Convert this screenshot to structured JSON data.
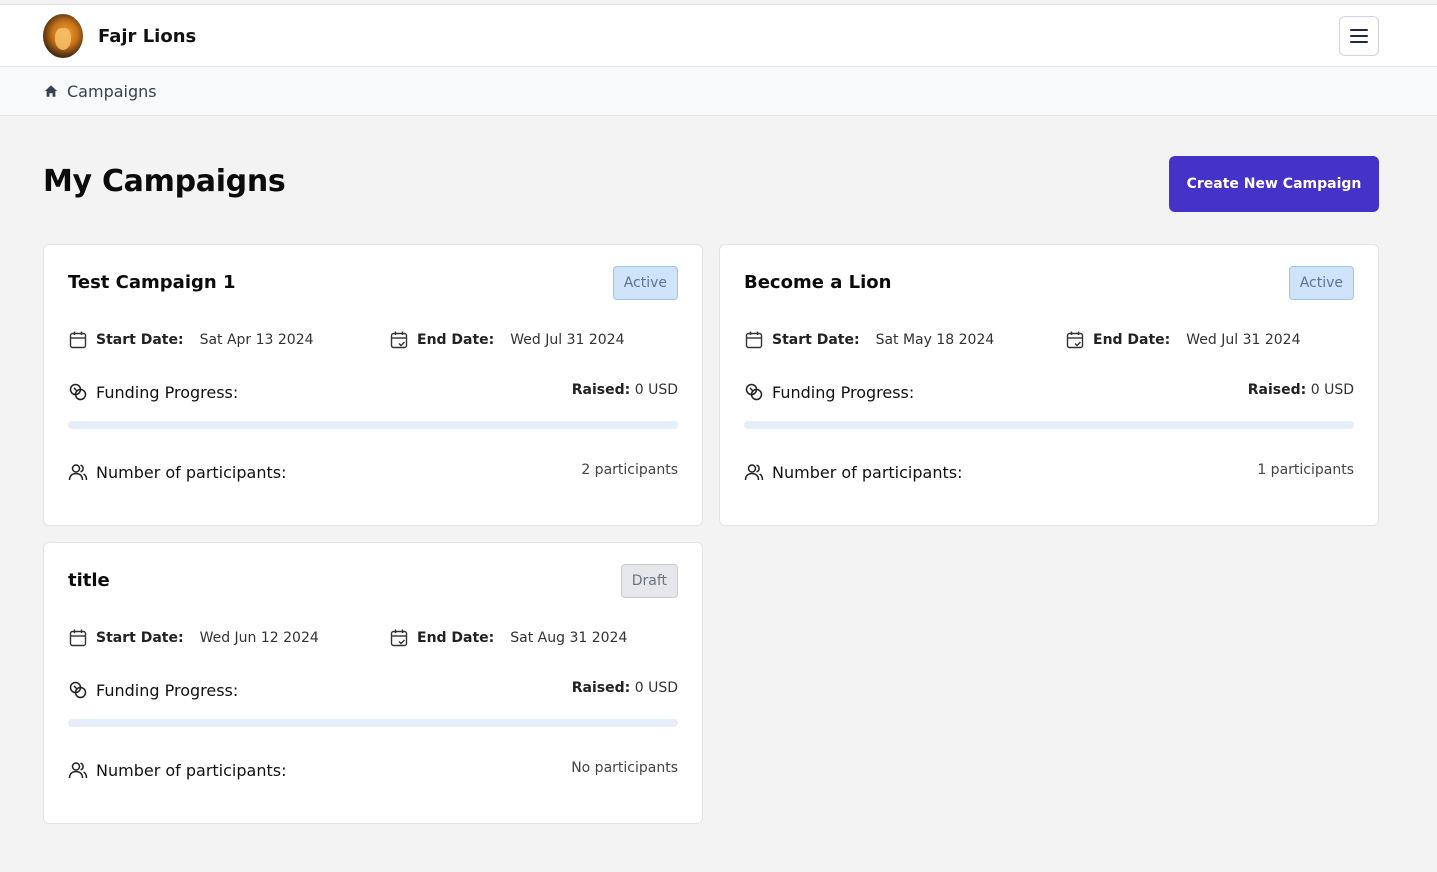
{
  "header": {
    "brand": "Fajr Lions",
    "logo_icon": "lion-logo-icon",
    "menu_icon": "hamburger-menu-icon"
  },
  "breadcrumb": {
    "home_icon": "home-icon",
    "current": "Campaigns"
  },
  "main": {
    "title": "My Campaigns",
    "create_button": "Create New Campaign",
    "accent_color": "#4533c9"
  },
  "labels": {
    "start_date": "Start Date:",
    "end_date": "End Date:",
    "funding_progress": "Funding Progress:",
    "raised": "Raised:",
    "participants": "Number of participants:"
  },
  "campaigns": [
    {
      "title": "Test Campaign 1",
      "status": "Active",
      "start_date": "Sat Apr 13 2024",
      "end_date": "Wed Jul 31 2024",
      "raised_value": "0 USD",
      "progress_fraction": 0,
      "participants": "2 participants"
    },
    {
      "title": "Become a Lion",
      "status": "Active",
      "start_date": "Sat May 18 2024",
      "end_date": "Wed Jul 31 2024",
      "raised_value": "0 USD",
      "progress_fraction": 0,
      "participants": "1 participants"
    },
    {
      "title": "title",
      "status": "Draft",
      "start_date": "Wed Jun 12 2024",
      "end_date": "Sat Aug 31 2024",
      "raised_value": "0 USD",
      "progress_fraction": 0,
      "participants": "No participants"
    }
  ]
}
